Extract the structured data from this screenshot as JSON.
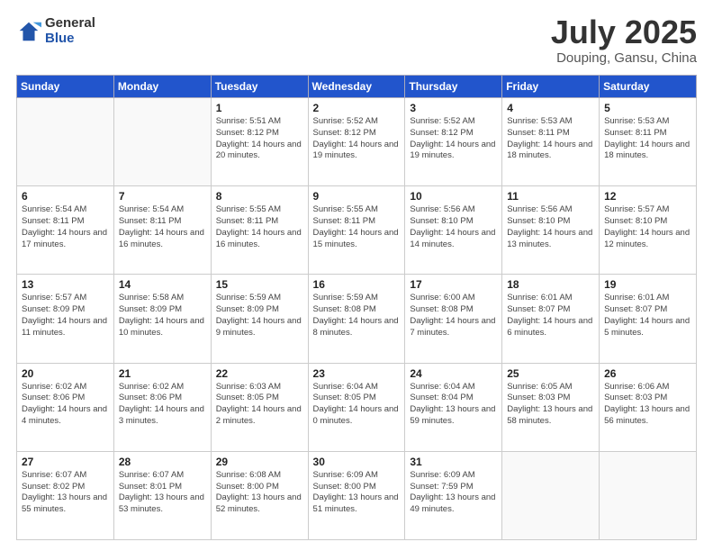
{
  "header": {
    "logo_general": "General",
    "logo_blue": "Blue",
    "title": "July 2025",
    "subtitle": "Douping, Gansu, China"
  },
  "days_of_week": [
    "Sunday",
    "Monday",
    "Tuesday",
    "Wednesday",
    "Thursday",
    "Friday",
    "Saturday"
  ],
  "weeks": [
    [
      {
        "day": "",
        "info": ""
      },
      {
        "day": "",
        "info": ""
      },
      {
        "day": "1",
        "info": "Sunrise: 5:51 AM\nSunset: 8:12 PM\nDaylight: 14 hours and 20 minutes."
      },
      {
        "day": "2",
        "info": "Sunrise: 5:52 AM\nSunset: 8:12 PM\nDaylight: 14 hours and 19 minutes."
      },
      {
        "day": "3",
        "info": "Sunrise: 5:52 AM\nSunset: 8:12 PM\nDaylight: 14 hours and 19 minutes."
      },
      {
        "day": "4",
        "info": "Sunrise: 5:53 AM\nSunset: 8:11 PM\nDaylight: 14 hours and 18 minutes."
      },
      {
        "day": "5",
        "info": "Sunrise: 5:53 AM\nSunset: 8:11 PM\nDaylight: 14 hours and 18 minutes."
      }
    ],
    [
      {
        "day": "6",
        "info": "Sunrise: 5:54 AM\nSunset: 8:11 PM\nDaylight: 14 hours and 17 minutes."
      },
      {
        "day": "7",
        "info": "Sunrise: 5:54 AM\nSunset: 8:11 PM\nDaylight: 14 hours and 16 minutes."
      },
      {
        "day": "8",
        "info": "Sunrise: 5:55 AM\nSunset: 8:11 PM\nDaylight: 14 hours and 16 minutes."
      },
      {
        "day": "9",
        "info": "Sunrise: 5:55 AM\nSunset: 8:11 PM\nDaylight: 14 hours and 15 minutes."
      },
      {
        "day": "10",
        "info": "Sunrise: 5:56 AM\nSunset: 8:10 PM\nDaylight: 14 hours and 14 minutes."
      },
      {
        "day": "11",
        "info": "Sunrise: 5:56 AM\nSunset: 8:10 PM\nDaylight: 14 hours and 13 minutes."
      },
      {
        "day": "12",
        "info": "Sunrise: 5:57 AM\nSunset: 8:10 PM\nDaylight: 14 hours and 12 minutes."
      }
    ],
    [
      {
        "day": "13",
        "info": "Sunrise: 5:57 AM\nSunset: 8:09 PM\nDaylight: 14 hours and 11 minutes."
      },
      {
        "day": "14",
        "info": "Sunrise: 5:58 AM\nSunset: 8:09 PM\nDaylight: 14 hours and 10 minutes."
      },
      {
        "day": "15",
        "info": "Sunrise: 5:59 AM\nSunset: 8:09 PM\nDaylight: 14 hours and 9 minutes."
      },
      {
        "day": "16",
        "info": "Sunrise: 5:59 AM\nSunset: 8:08 PM\nDaylight: 14 hours and 8 minutes."
      },
      {
        "day": "17",
        "info": "Sunrise: 6:00 AM\nSunset: 8:08 PM\nDaylight: 14 hours and 7 minutes."
      },
      {
        "day": "18",
        "info": "Sunrise: 6:01 AM\nSunset: 8:07 PM\nDaylight: 14 hours and 6 minutes."
      },
      {
        "day": "19",
        "info": "Sunrise: 6:01 AM\nSunset: 8:07 PM\nDaylight: 14 hours and 5 minutes."
      }
    ],
    [
      {
        "day": "20",
        "info": "Sunrise: 6:02 AM\nSunset: 8:06 PM\nDaylight: 14 hours and 4 minutes."
      },
      {
        "day": "21",
        "info": "Sunrise: 6:02 AM\nSunset: 8:06 PM\nDaylight: 14 hours and 3 minutes."
      },
      {
        "day": "22",
        "info": "Sunrise: 6:03 AM\nSunset: 8:05 PM\nDaylight: 14 hours and 2 minutes."
      },
      {
        "day": "23",
        "info": "Sunrise: 6:04 AM\nSunset: 8:05 PM\nDaylight: 14 hours and 0 minutes."
      },
      {
        "day": "24",
        "info": "Sunrise: 6:04 AM\nSunset: 8:04 PM\nDaylight: 13 hours and 59 minutes."
      },
      {
        "day": "25",
        "info": "Sunrise: 6:05 AM\nSunset: 8:03 PM\nDaylight: 13 hours and 58 minutes."
      },
      {
        "day": "26",
        "info": "Sunrise: 6:06 AM\nSunset: 8:03 PM\nDaylight: 13 hours and 56 minutes."
      }
    ],
    [
      {
        "day": "27",
        "info": "Sunrise: 6:07 AM\nSunset: 8:02 PM\nDaylight: 13 hours and 55 minutes."
      },
      {
        "day": "28",
        "info": "Sunrise: 6:07 AM\nSunset: 8:01 PM\nDaylight: 13 hours and 53 minutes."
      },
      {
        "day": "29",
        "info": "Sunrise: 6:08 AM\nSunset: 8:00 PM\nDaylight: 13 hours and 52 minutes."
      },
      {
        "day": "30",
        "info": "Sunrise: 6:09 AM\nSunset: 8:00 PM\nDaylight: 13 hours and 51 minutes."
      },
      {
        "day": "31",
        "info": "Sunrise: 6:09 AM\nSunset: 7:59 PM\nDaylight: 13 hours and 49 minutes."
      },
      {
        "day": "",
        "info": ""
      },
      {
        "day": "",
        "info": ""
      }
    ]
  ]
}
